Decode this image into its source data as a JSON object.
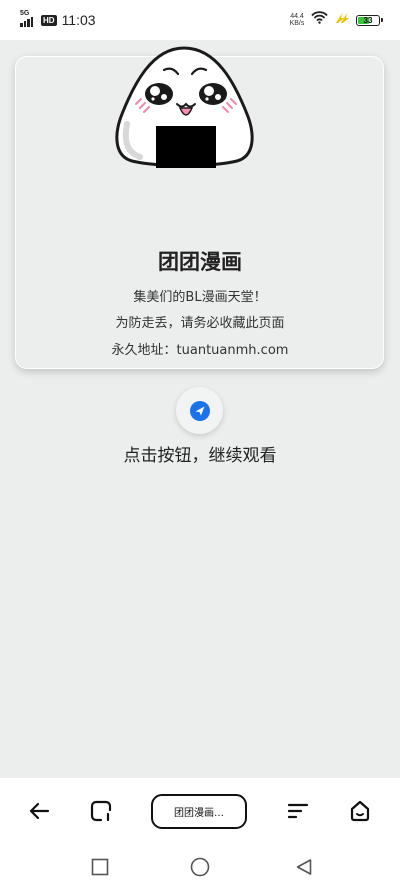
{
  "status_bar": {
    "network": "5G",
    "hd_badge": "HD",
    "time": "11:03",
    "speed_value": "44.4",
    "speed_unit": "KB/s",
    "battery_level": "33"
  },
  "card": {
    "title": "团团漫画",
    "line1": "集美们的BL漫画天堂！",
    "line2": "为防走丢，请务必收藏此页面",
    "line3": "永久地址：tuantuanmh.com"
  },
  "cta": {
    "caption": "点击按钮，继续观看"
  },
  "toolbar": {
    "tab_title": "团团漫画…"
  },
  "icons": {
    "back": "arrow-left-icon",
    "tabs": "tabs-icon",
    "menu": "menu-icon",
    "home": "home-icon",
    "send": "send-icon"
  },
  "colors": {
    "accent_blue": "#1a73e8",
    "battery_green": "#37c53c",
    "background": "#eceded"
  }
}
